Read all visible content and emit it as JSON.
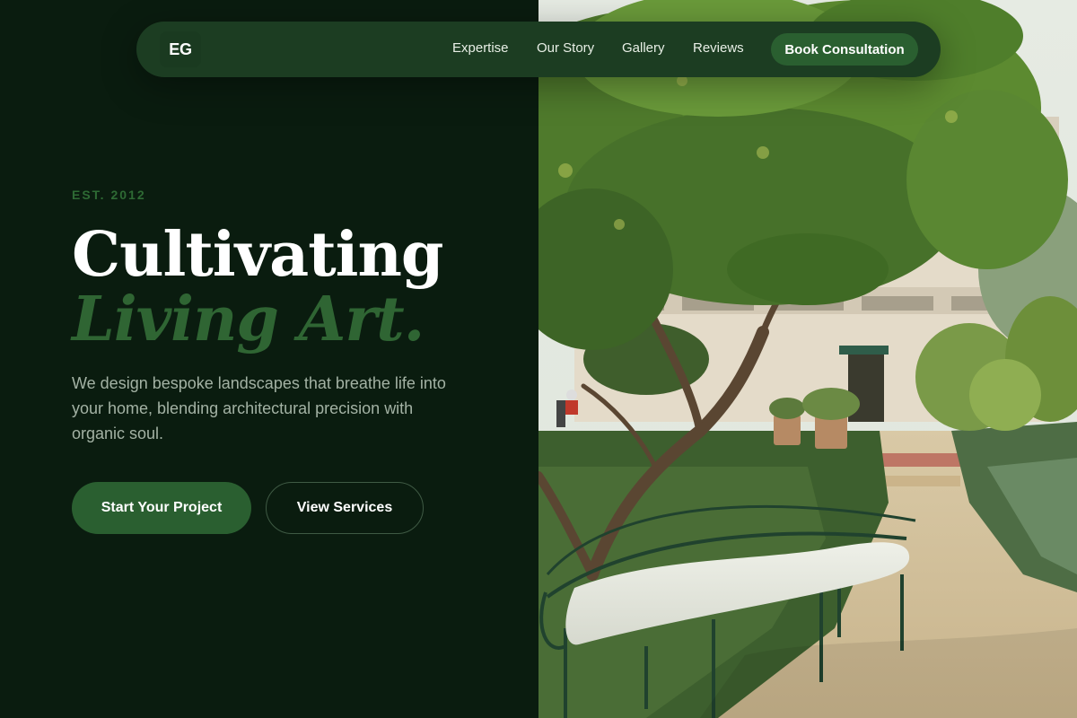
{
  "nav": {
    "logo": "EG",
    "links": [
      "Expertise",
      "Our Story",
      "Gallery",
      "Reviews"
    ],
    "cta": "Book Consultation"
  },
  "hero": {
    "eyebrow": "EST. 2012",
    "headline_line1": "Cultivating",
    "headline_line2": "Living Art.",
    "subtitle": "We design bespoke landscapes that breathe life into your home, blending architectural precision with organic soul.",
    "primary_button": "Start Your Project",
    "secondary_button": "View Services"
  },
  "image": {
    "description_icon": "garden-photo",
    "alt": ""
  },
  "colors": {
    "background": "#0a1c0f",
    "accent": "#2a5f30",
    "accent_text": "#2f6533",
    "nav_bg": "#1c3d22"
  }
}
